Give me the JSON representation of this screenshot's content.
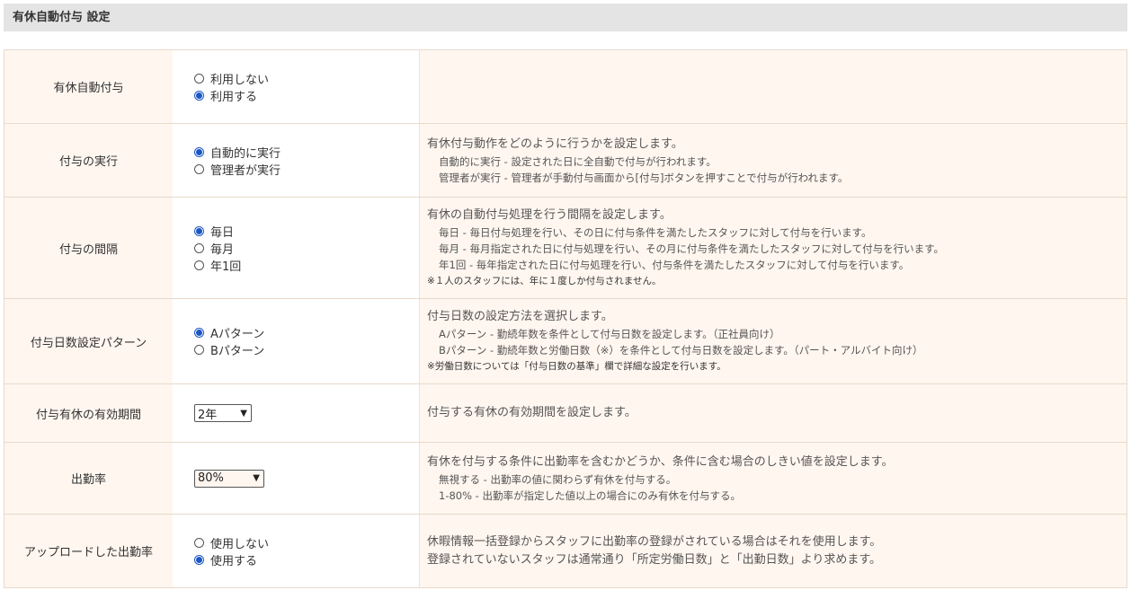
{
  "header": {
    "title": "有休自動付与 設定"
  },
  "rows": {
    "auto_grant": {
      "label": "有休自動付与",
      "options": [
        "利用しない",
        "利用する"
      ],
      "selected_index": 1
    },
    "execution": {
      "label": "付与の実行",
      "options": [
        "自動的に実行",
        "管理者が実行"
      ],
      "selected_index": 0,
      "desc_title": "有休付与動作をどのように行うかを設定します。",
      "desc_lines": [
        "自動的に実行 - 設定された日に全自動で付与が行われます。",
        "管理者が実行 - 管理者が手動付与画面から[付与]ボタンを押すことで付与が行われます。"
      ]
    },
    "interval": {
      "label": "付与の間隔",
      "options": [
        "毎日",
        "毎月",
        "年1回"
      ],
      "selected_index": 0,
      "desc_title": "有休の自動付与処理を行う間隔を設定します。",
      "desc_lines": [
        "毎日 - 毎日付与処理を行い、その日に付与条件を満たしたスタッフに対して付与を行います。",
        "毎月 - 毎月指定された日に付与処理を行い、その月に付与条件を満たしたスタッフに対して付与を行います。",
        "年1回 - 毎年指定された日に付与処理を行い、付与条件を満たしたスタッフに対して付与を行います。"
      ],
      "desc_note": "※１人のスタッフには、年に１度しか付与されません。"
    },
    "pattern": {
      "label": "付与日数設定パターン",
      "options": [
        "Aパターン",
        "Bパターン"
      ],
      "selected_index": 0,
      "desc_title": "付与日数の設定方法を選択します。",
      "desc_lines": [
        "Aパターン - 勤続年数を条件として付与日数を設定します。（正社員向け）",
        "Bパターン - 勤続年数と労働日数（※）を条件として付与日数を設定します。（パート・アルバイト向け）"
      ],
      "desc_note": "※労働日数については「付与日数の基準」欄で詳細な設定を行います。"
    },
    "validity": {
      "label": "付与有休の有効期間",
      "select_value": "2年",
      "desc_title": "付与する有休の有効期間を設定します。"
    },
    "attendance": {
      "label": "出勤率",
      "select_value": "80%",
      "desc_title": "有休を付与する条件に出勤率を含むかどうか、条件に含む場合のしきい値を設定します。",
      "desc_lines": [
        "無視する - 出勤率の値に関わらず有休を付与する。",
        "1-80% - 出勤率が指定した値以上の場合にのみ有休を付与する。"
      ]
    },
    "uploaded_rate": {
      "label": "アップロードした出勤率",
      "options": [
        "使用しない",
        "使用する"
      ],
      "selected_index": 1,
      "desc_title": "休暇情報一括登録からスタッフに出勤率の登録がされている場合はそれを使用します。",
      "desc_title2": "登録されていないスタッフは通常通り「所定労働日数」と「出勤日数」より求めます。"
    }
  }
}
